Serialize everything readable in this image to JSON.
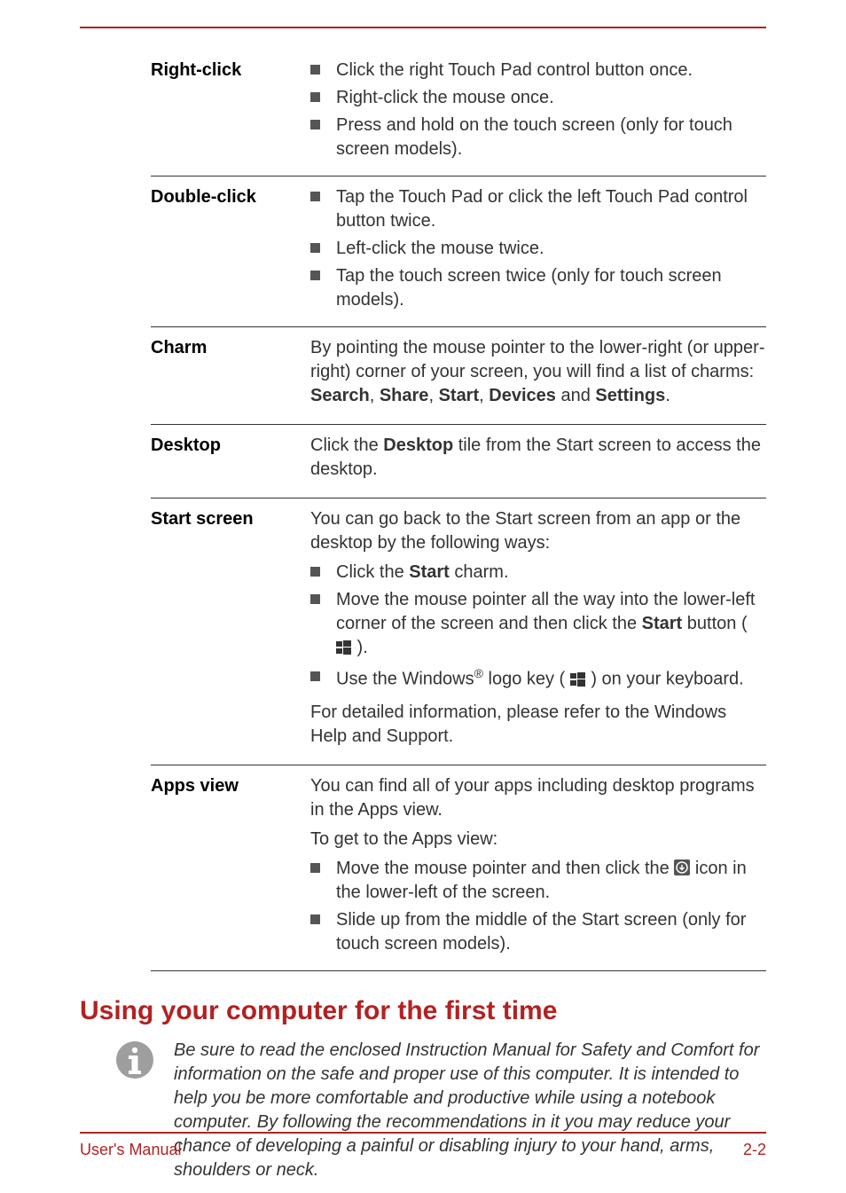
{
  "rows": {
    "rightclick": {
      "term": "Right-click",
      "items": [
        "Click the right Touch Pad control button once.",
        "Right-click the mouse once.",
        "Press and hold on the touch screen (only for touch screen models)."
      ]
    },
    "doubleclick": {
      "term": "Double-click",
      "items": [
        "Tap the Touch Pad or click the left Touch Pad control button twice.",
        "Left-click the mouse twice.",
        "Tap the touch screen twice (only for touch screen models)."
      ]
    },
    "charm": {
      "term": "Charm",
      "text_pre": "By pointing the mouse pointer to the lower-right (or upper-right) corner of your screen, you will find a list of charms: ",
      "bold1": "Search",
      "sep1": ", ",
      "bold2": "Share",
      "sep2": ", ",
      "bold3": "Start",
      "sep3": ", ",
      "bold4": "Devices",
      "mid": " and ",
      "bold5": "Settings",
      "end": "."
    },
    "desktop": {
      "term": "Desktop",
      "pre": "Click the ",
      "bold": "Desktop",
      "post": " tile from the Start screen to access the desktop."
    },
    "startscreen": {
      "term": "Start screen",
      "intro": "You can go back to the Start screen from an app or the desktop by the following ways:",
      "item1_pre": "Click the ",
      "item1_bold": "Start",
      "item1_post": " charm.",
      "item2_pre": "Move the mouse pointer all the way into the lower-left corner of the screen and then click the ",
      "item2_bold": "Start",
      "item2_post": " button ( ",
      "item2_end": " ).",
      "item3_pre": "Use the Windows",
      "item3_mid": " logo key ( ",
      "item3_post": " ) on your keyboard.",
      "outro": "For detailed information, please refer to the Windows Help and Support."
    },
    "appsview": {
      "term": "Apps view",
      "intro": "You can find all of your apps including desktop programs in the Apps view.",
      "lead": "To get to the Apps view:",
      "item1_pre": "Move the mouse pointer and then click the ",
      "item1_post": " icon in the lower-left of the screen.",
      "item2": "Slide up from the middle of the Start screen (only for touch screen models)."
    }
  },
  "section_heading": "Using your computer for the first time",
  "note": "Be sure to read the enclosed Instruction Manual for Safety and Comfort for information on the safe and proper use of this computer. It is intended to help you be more comfortable and productive while using a notebook computer. By following the recommendations in it you may reduce your chance of developing a painful or disabling injury to your hand, arms, shoulders or neck.",
  "footer_left": "User's Manual",
  "footer_right": "2-2",
  "sup_reg": "®"
}
